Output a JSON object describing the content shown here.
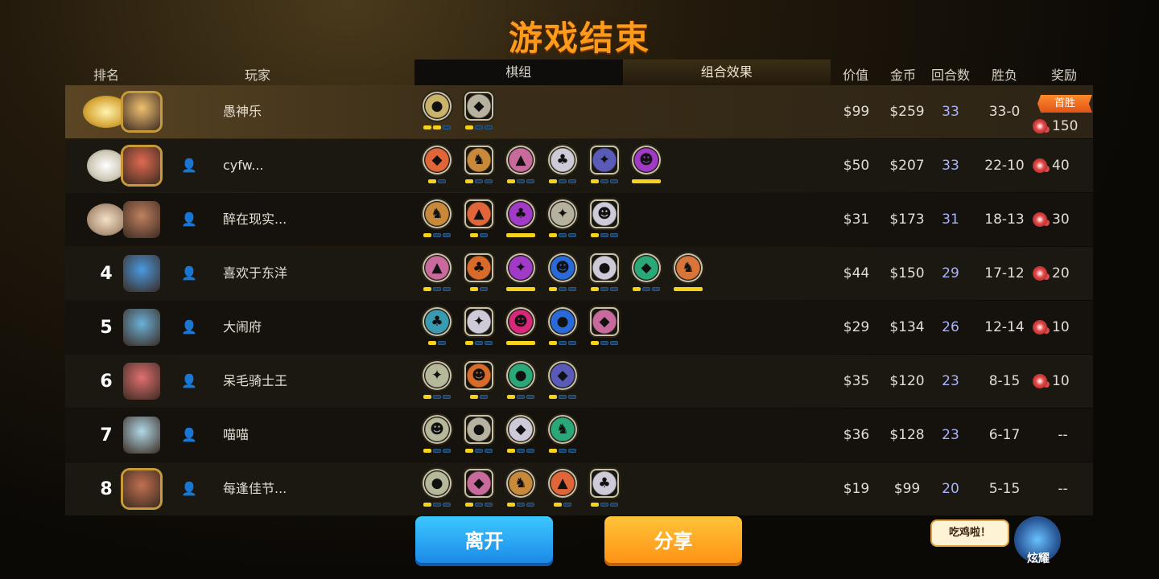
{
  "title": "游戏结束",
  "headers": {
    "rank": "排名",
    "player": "玩家",
    "tab_pieces": "棋组",
    "tab_synergy": "组合效果",
    "value": "价值",
    "gold": "金币",
    "rounds": "回合数",
    "winloss": "胜负",
    "reward": "奖励"
  },
  "first_win_label": "首胜",
  "colors": {
    "accent": "#ff9a1a",
    "rounds": "#aab3ff",
    "pip_on": "#f7d21c",
    "pip_off": "#1a3a5c"
  },
  "rows": [
    {
      "rank": "",
      "medal": "gold",
      "name": "愚神乐",
      "value": "$99",
      "gold": "$259",
      "rounds": "33",
      "winloss": "33-0",
      "reward": "150",
      "traits": [
        {
          "icon": "trait-icon",
          "color": "#c9b36a",
          "pips": [
            1,
            1,
            0
          ]
        },
        {
          "icon": "trait-icon",
          "color": "#b7b1a0",
          "pips": [
            1,
            0,
            0
          ]
        }
      ]
    },
    {
      "rank": "",
      "medal": "silver",
      "name": "cyfw...",
      "value": "$50",
      "gold": "$207",
      "rounds": "33",
      "winloss": "22-10",
      "reward": "40",
      "traits": [
        {
          "icon": "trait-icon",
          "color": "#e0663a",
          "pips": [
            1,
            0
          ]
        },
        {
          "icon": "trait-icon",
          "color": "#c9893a",
          "pips": [
            1,
            0,
            0
          ]
        },
        {
          "icon": "trait-icon",
          "color": "#c86a9c",
          "pips": [
            1,
            0,
            0
          ]
        },
        {
          "icon": "trait-icon",
          "color": "#cfcad8",
          "pips": [
            1,
            0,
            0
          ]
        },
        {
          "icon": "trait-icon",
          "color": "#5a5ab8",
          "pips": [
            1,
            0,
            0
          ]
        },
        {
          "icon": "trait-icon",
          "color": "#a23ac8",
          "pips": [
            2
          ]
        }
      ]
    },
    {
      "rank": "",
      "medal": "bronze",
      "name": "醉在现实...",
      "value": "$31",
      "gold": "$173",
      "rounds": "31",
      "winloss": "18-13",
      "reward": "30",
      "traits": [
        {
          "icon": "trait-icon",
          "color": "#c9893a",
          "pips": [
            1,
            0,
            0
          ]
        },
        {
          "icon": "trait-icon",
          "color": "#e0663a",
          "pips": [
            1,
            0
          ]
        },
        {
          "icon": "trait-icon",
          "color": "#a23ac8",
          "pips": [
            2
          ]
        },
        {
          "icon": "trait-icon",
          "color": "#b7b1a0",
          "pips": [
            1,
            0,
            0
          ]
        },
        {
          "icon": "trait-icon",
          "color": "#cfcad8",
          "pips": [
            1,
            0,
            0
          ]
        }
      ]
    },
    {
      "rank": "4",
      "medal": "",
      "name": "喜欢于东洋",
      "value": "$44",
      "gold": "$150",
      "rounds": "29",
      "winloss": "17-12",
      "reward": "20",
      "traits": [
        {
          "icon": "trait-icon",
          "color": "#c86a9c",
          "pips": [
            1,
            0,
            0
          ]
        },
        {
          "icon": "trait-icon",
          "color": "#d86a2a",
          "pips": [
            1,
            0
          ]
        },
        {
          "icon": "trait-icon",
          "color": "#a23ac8",
          "pips": [
            2
          ]
        },
        {
          "icon": "trait-icon",
          "color": "#2a6ad8",
          "pips": [
            1,
            0,
            0
          ]
        },
        {
          "icon": "trait-icon",
          "color": "#cfcad8",
          "pips": [
            1,
            0,
            0
          ]
        },
        {
          "icon": "trait-icon",
          "color": "#2aa878",
          "pips": [
            1,
            0,
            0
          ]
        },
        {
          "icon": "trait-icon",
          "color": "#d8763a",
          "pips": [
            2
          ]
        }
      ]
    },
    {
      "rank": "5",
      "medal": "",
      "name": "大闹府",
      "value": "$29",
      "gold": "$134",
      "rounds": "26",
      "winloss": "12-14",
      "reward": "10",
      "traits": [
        {
          "icon": "trait-icon",
          "color": "#3a9ab0",
          "pips": [
            1,
            0
          ]
        },
        {
          "icon": "trait-icon",
          "color": "#cfcad8",
          "pips": [
            1,
            0,
            0
          ]
        },
        {
          "icon": "trait-icon",
          "color": "#d8287a",
          "pips": [
            2
          ]
        },
        {
          "icon": "trait-icon",
          "color": "#2a6ad8",
          "pips": [
            1,
            0,
            0
          ]
        },
        {
          "icon": "trait-icon",
          "color": "#c86a9c",
          "pips": [
            1,
            0,
            0
          ]
        }
      ]
    },
    {
      "rank": "6",
      "medal": "",
      "name": "呆毛骑士王",
      "value": "$35",
      "gold": "$120",
      "rounds": "23",
      "winloss": "8-15",
      "reward": "10",
      "traits": [
        {
          "icon": "trait-icon",
          "color": "#b6b89a",
          "pips": [
            1,
            0,
            0
          ]
        },
        {
          "icon": "trait-icon",
          "color": "#d86a2a",
          "pips": [
            1,
            0
          ]
        },
        {
          "icon": "trait-icon",
          "color": "#2aa878",
          "pips": [
            1,
            0,
            0
          ]
        },
        {
          "icon": "trait-icon",
          "color": "#5a5ab8",
          "pips": [
            1,
            0,
            0
          ]
        }
      ]
    },
    {
      "rank": "7",
      "medal": "",
      "name": "喵喵",
      "value": "$36",
      "gold": "$128",
      "rounds": "23",
      "winloss": "6-17",
      "reward": "--",
      "traits": [
        {
          "icon": "trait-icon",
          "color": "#b6b89a",
          "pips": [
            1,
            0,
            0
          ]
        },
        {
          "icon": "trait-icon",
          "color": "#b7b1a0",
          "pips": [
            1,
            0,
            0
          ]
        },
        {
          "icon": "trait-icon",
          "color": "#cfcad8",
          "pips": [
            1,
            0,
            0
          ]
        },
        {
          "icon": "trait-icon",
          "color": "#2aa878",
          "pips": [
            1,
            0,
            0
          ]
        }
      ]
    },
    {
      "rank": "8",
      "medal": "",
      "name": "每逢佳节...",
      "value": "$19",
      "gold": "$99",
      "rounds": "20",
      "winloss": "5-15",
      "reward": "--",
      "traits": [
        {
          "icon": "trait-icon",
          "color": "#b6b89a",
          "pips": [
            1,
            0,
            0
          ]
        },
        {
          "icon": "trait-icon",
          "color": "#c86a9c",
          "pips": [
            1,
            0,
            0
          ]
        },
        {
          "icon": "trait-icon",
          "color": "#c9893a",
          "pips": [
            1,
            0,
            0
          ]
        },
        {
          "icon": "trait-icon",
          "color": "#e0663a",
          "pips": [
            1,
            0
          ]
        },
        {
          "icon": "trait-icon",
          "color": "#cfcad8",
          "pips": [
            1,
            0,
            0
          ]
        }
      ]
    }
  ],
  "buttons": {
    "leave": "离开",
    "share": "分享"
  },
  "bubble": "吃鸡啦！",
  "mascot_label": "炫耀"
}
